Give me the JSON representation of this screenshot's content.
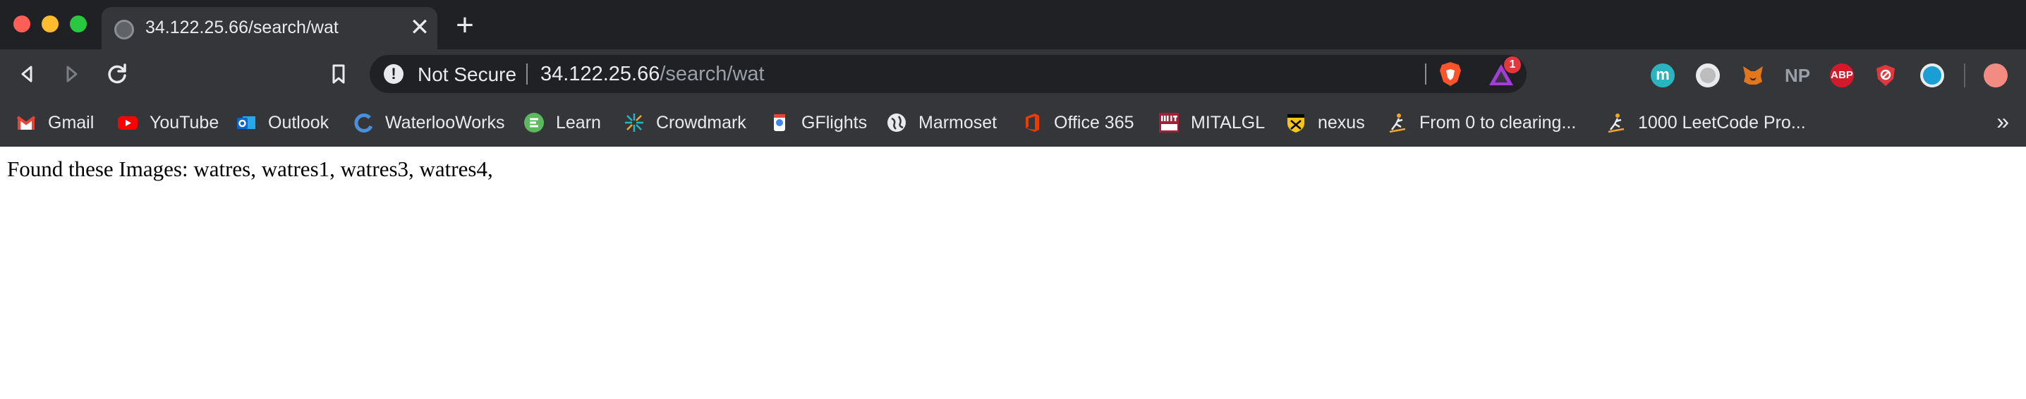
{
  "tab": {
    "title": "34.122.25.66/search/wat",
    "close_glyph": "✕",
    "new_tab_glyph": "+"
  },
  "toolbar": {
    "security_label": "Not Secure",
    "url_host": "34.122.25.66",
    "url_path": "/search/wat",
    "rewards_badge": "1",
    "extensions": {
      "meet_letter": "m",
      "np_label": "NP",
      "abp_label": "ABP"
    }
  },
  "bookmarks": [
    {
      "label": "Gmail",
      "icon": "gmail-icon",
      "color": "#ea4335"
    },
    {
      "label": "YouTube",
      "icon": "youtube-icon",
      "color": "#ff0000"
    },
    {
      "label": "Outlook",
      "icon": "outlook-icon",
      "color": "#0a64d2"
    },
    {
      "label": "WaterlooWorks",
      "icon": "waterlooworks-icon",
      "color": "#4a90d9"
    },
    {
      "label": "Learn",
      "icon": "learn-icon",
      "color": "#5cb85c"
    },
    {
      "label": "Crowdmark",
      "icon": "crowdmark-icon",
      "color": "#2bb3c0"
    },
    {
      "label": "GFlights",
      "icon": "gflights-icon",
      "color": "#4285f4"
    },
    {
      "label": "Marmoset",
      "icon": "globe-icon",
      "color": "#e8eaed"
    },
    {
      "label": "Office 365",
      "icon": "office-icon",
      "color": "#eb3c00"
    },
    {
      "label": "MITALGL",
      "icon": "mit-ocw-icon",
      "color": "#e8eaed"
    },
    {
      "label": "nexus",
      "icon": "waterloo-shield-icon",
      "color": "#f5c518"
    },
    {
      "label": "From 0 to clearing...",
      "icon": "climber-icon",
      "color": "#f5a623"
    },
    {
      "label": "1000 LeetCode Pro...",
      "icon": "climber-icon",
      "color": "#f5a623"
    }
  ],
  "bookmarks_overflow_glyph": "»",
  "page": {
    "result_text": "Found these Images: watres, watres1, watres3, watres4,"
  },
  "colors": {
    "titlebar": "#202124",
    "toolbar": "#35363a",
    "omnibox": "#202124",
    "text_light": "#e8eaed",
    "url_path": "#9aa0a6"
  }
}
